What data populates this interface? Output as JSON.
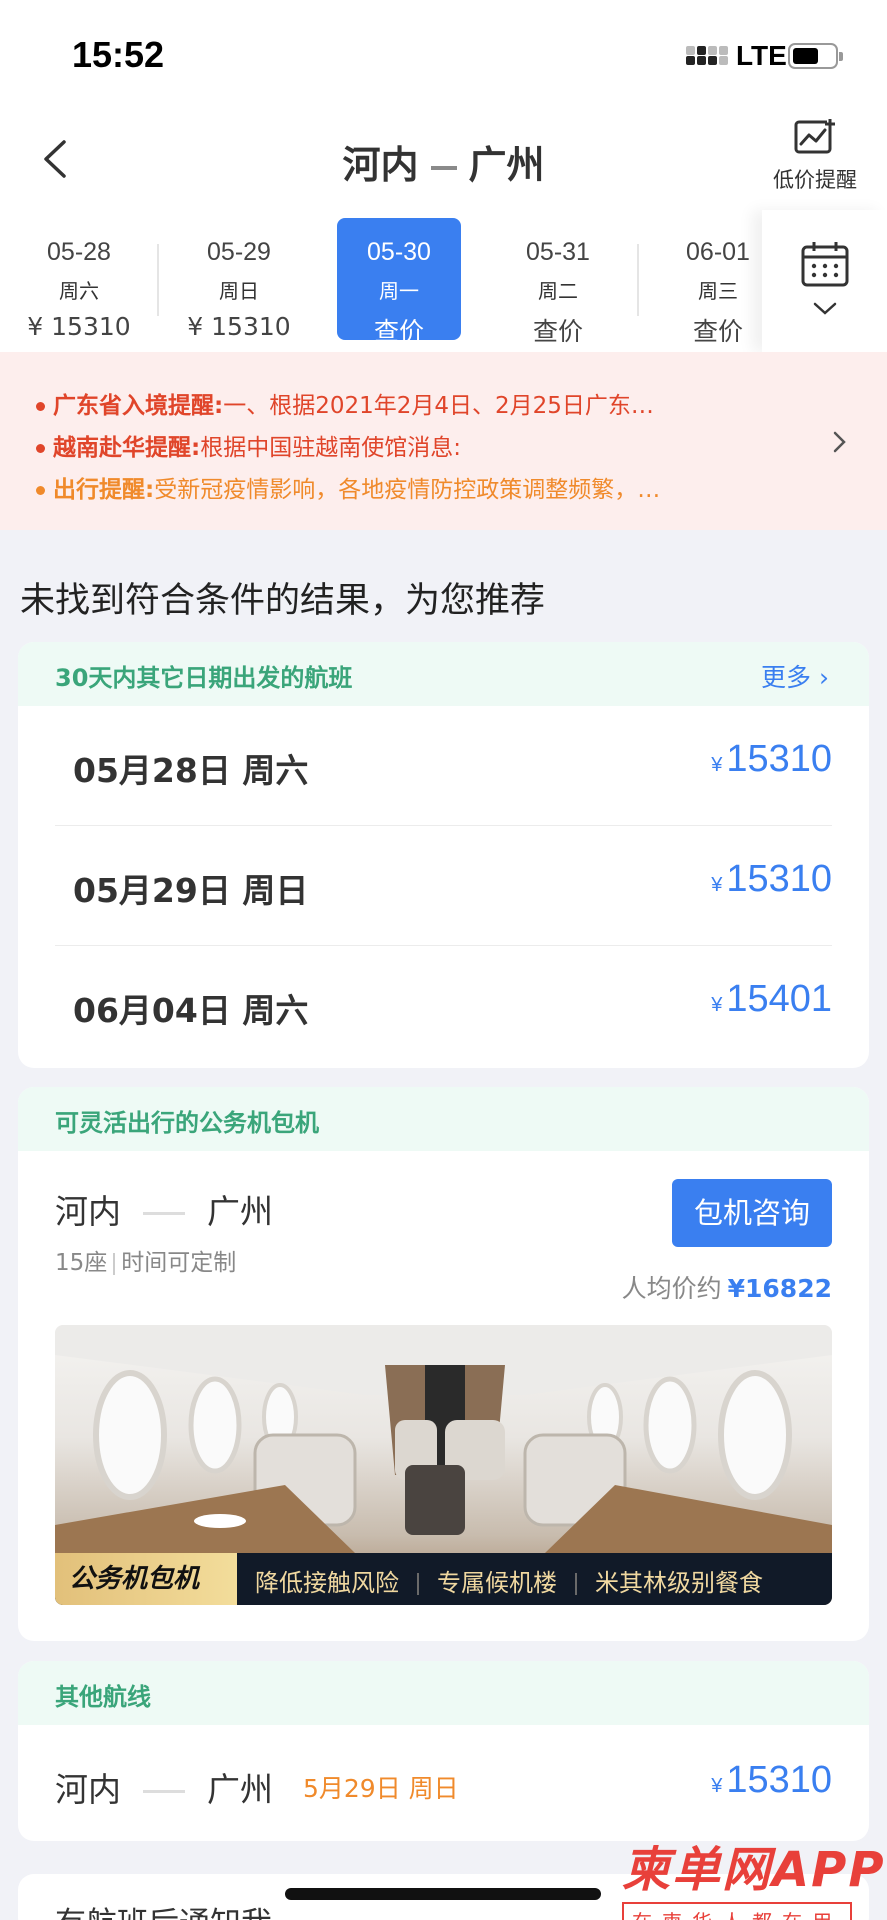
{
  "status": {
    "time": "15:52",
    "network": "LTE"
  },
  "header": {
    "route_from": "河内",
    "route_to": "广州",
    "alert_label": "低价提醒"
  },
  "dates": [
    {
      "date": "05-28",
      "weekday": "周六",
      "price": "¥ 15310",
      "active": false
    },
    {
      "date": "05-29",
      "weekday": "周日",
      "price": "¥ 15310",
      "active": false
    },
    {
      "date": "05-30",
      "weekday": "周一",
      "price": "查价",
      "active": true
    },
    {
      "date": "05-31",
      "weekday": "周二",
      "price": "查价",
      "active": false
    },
    {
      "date": "06-01",
      "weekday": "周三",
      "price": "查价",
      "active": false
    }
  ],
  "notices": [
    {
      "title": "广东省入境提醒:",
      "text": "一、根据2021年2月4日、2月25日广东…"
    },
    {
      "title": "越南赴华提醒:",
      "text": "根据中国驻越南使馆消息:"
    },
    {
      "title": "出行提醒:",
      "text": "受新冠疫情影响，各地疫情防控政策调整频繁，…"
    }
  ],
  "section_title": "未找到符合条件的结果，为您推荐",
  "other_dates": {
    "title": "30天内其它日期出发的航班",
    "more": "更多",
    "flights": [
      {
        "date": "05月28日 周六",
        "currency": "¥",
        "price": "15310"
      },
      {
        "date": "05月29日 周日",
        "currency": "¥",
        "price": "15310"
      },
      {
        "date": "06月04日 周六",
        "currency": "¥",
        "price": "15401"
      }
    ]
  },
  "charter": {
    "title": "可灵活出行的公务机包机",
    "from": "河内",
    "to": "广州",
    "seats": "15座",
    "custom": "时间可定制",
    "button": "包机咨询",
    "avg_label": "人均价约",
    "avg_price": "¥16822",
    "banner_tag": "公务机包机",
    "banner_items": [
      "降低接触风险",
      "专属候机楼",
      "米其林级别餐食"
    ]
  },
  "other_routes": {
    "title": "其他航线",
    "from": "河内",
    "to": "广州",
    "date": "5月29日 周日",
    "currency": "¥",
    "price": "15310"
  },
  "bottom_text": "有航班后通知我",
  "watermark": {
    "brand": "柬单网APP",
    "slogan": "在柬华人都在用"
  },
  "colors": {
    "accent": "#3a7ff0",
    "green": "#3aa57a",
    "red": "#e0452a",
    "orange": "#f08a2b"
  }
}
